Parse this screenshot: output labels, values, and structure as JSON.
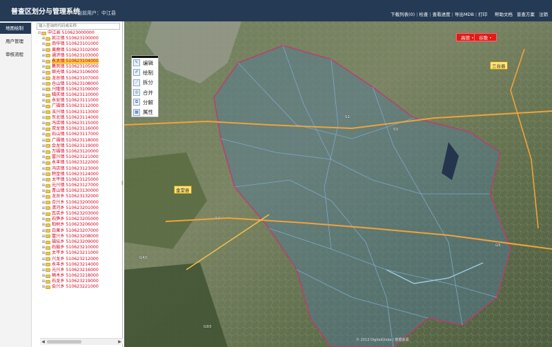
{
  "header": {
    "app_title": "普查区划分与管理系统",
    "user_label": "当前用户：中江县",
    "links": [
      "下载列表(0)",
      "检查",
      "查看进度",
      "导出MDB",
      "打印"
    ],
    "right_links": [
      "帮助文档",
      "普查方案",
      "注销"
    ]
  },
  "nav": {
    "items": [
      "地图绘制",
      "用户管理",
      "审核流程"
    ]
  },
  "tree": {
    "search_placeholder": "输入查询的代码或名称",
    "root": "中江县 510623000000",
    "items": [
      "凯江镇 510623100000",
      "南华镇 510623101000",
      "黄鹿镇 510623102000",
      "通济镇 510623103000",
      "永太镇 510623104000",
      "集凤镇 510623105000",
      "继光镇 510623106000",
      "龙台镇 510623107000",
      "仓山镇 510623108000",
      "兴隆镇 510623109000",
      "辑庆镇 510623110000",
      "永安镇 510623111000",
      "广福镇 510623112000",
      "玉兴镇 510623113000",
      "东北镇 510623114000",
      "冯店镇 510623115000",
      "双龙镇 510623116000",
      "石山镇 510623117000",
      "广福镇 510623118000",
      "会龙镇 510623119000",
      "万福镇 510623120000",
      "富兴镇 510623121000",
      "永丰镇 510623122000",
      "冯店镇 510623123000",
      "积金镇 510623124000",
      "太平镇 510623125000",
      "元兴镇 510623127000",
      "青山镇 510623130000",
      "龙台乡 510623132000",
      "合兴乡 510623200000",
      "清河乡 510623201000",
      "瓦店乡 510623203000",
      "石笋乡 510623205000",
      "柏树乡 510623206000",
      "白果乡 510623207000",
      "富兴乡 510623208000",
      "福坛乡 510623209000",
      "石鼓乡 510623210000",
      "太平乡 510623211000",
      "兴龙乡 510623212000",
      "永丰乡 510623214000",
      "元兴乡 510623216000",
      "楠木乡 510623218000",
      "石龙乡 510623219000",
      "会兴乡 510623221000"
    ],
    "selected_index": 4
  },
  "tools": [
    "编辑",
    "绘制",
    "拆分",
    "合并",
    "分解",
    "属性"
  ],
  "map": {
    "badges": [
      "高德",
      "谷歌"
    ],
    "city_labels": [
      "金堂县",
      "三台县"
    ],
    "road_labels": [
      "S1",
      "G42",
      "S2",
      "G93",
      "S3",
      "G5"
    ],
    "copyright": "© 2013 DigitalGlobe / 数据来源"
  }
}
